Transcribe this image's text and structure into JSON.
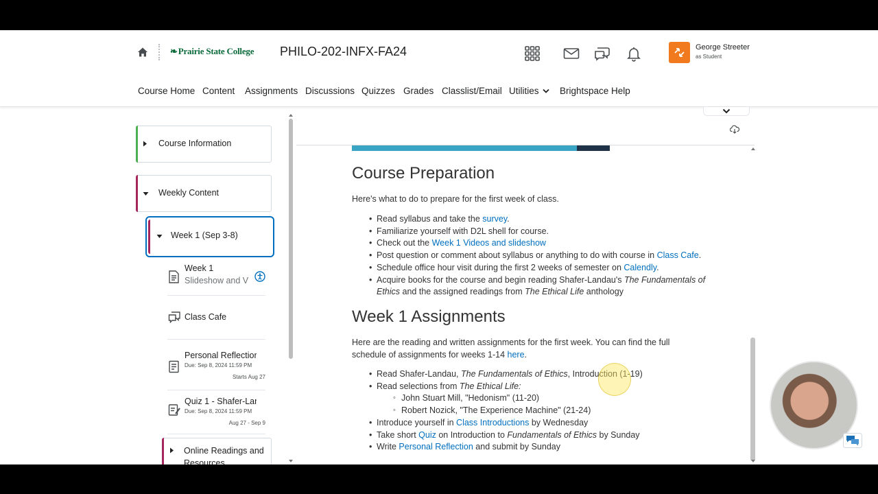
{
  "header": {
    "college_name": "Prairie State College",
    "course_code": "PHILO-202-INFX-FA24",
    "user_name": "George Streeter",
    "user_role": "as Student",
    "accent_color": "#f27a1e",
    "icons": [
      "home-icon",
      "apps-grid-icon",
      "mail-icon",
      "chat-icon",
      "bell-icon"
    ]
  },
  "nav": {
    "items": [
      "Course Home",
      "Content",
      "Assignments",
      "Discussions",
      "Quizzes",
      "Grades",
      "Classlist/Email",
      "Utilities",
      "Brightspace Help"
    ]
  },
  "sidebar": {
    "modules": [
      {
        "label": "Course Information",
        "bar_color": "#4caf50"
      },
      {
        "label": "Weekly Content",
        "bar_color": "#a3275d"
      },
      {
        "label": "Week 1 (Sep 3-8)",
        "bar_color": "#a3275d"
      },
      {
        "label": "Online Readings and Resources",
        "bar_color": "#a3275d"
      }
    ],
    "topics": [
      {
        "line1": "Week 1",
        "line2": "Slideshow and V",
        "icon": "document-icon"
      },
      {
        "name": "Class Cafe",
        "icon": "discussion-icon"
      },
      {
        "name": "Personal Reflection",
        "due": "Due: Sep 8, 2024 11:59 PM",
        "dates": "Starts Aug 27",
        "icon": "assignment-icon"
      },
      {
        "name": "Quiz 1 - Shafer-Lan",
        "due": "Due: Sep 8, 2024 11:59 PM",
        "dates": "Aug 27 - Sep 9",
        "icon": "quiz-icon"
      }
    ]
  },
  "doc": {
    "prep_heading": "Course Preparation",
    "prep_intro": "Here's what to do to prepare for the first week of class.",
    "prep_items": {
      "i1_pre": "Read syllabus and take the ",
      "i1_link": "survey",
      "i1_post": ".",
      "i2": "Familiarize yourself with D2L shell for course.",
      "i3_pre": "Check out the ",
      "i3_link": "Week 1 Videos and slideshow",
      "i4_pre": "Post question or comment about syllabus or anything to do with course in ",
      "i4_link": "Class Cafe",
      "i4_post": ".",
      "i5_pre": "Schedule office hour visit during the first 2 weeks of semester on ",
      "i5_link": "Calendly",
      "i5_post": ".",
      "i6_pre": "Acquire books for the course and begin reading Shafer-Landau's ",
      "i6_em1": "The Fundamentals of Ethics",
      "i6_mid": " and the assigned readings from ",
      "i6_em2": "The Ethical Life",
      "i6_post": " anthology"
    },
    "assign_heading": "Week 1 Assignments",
    "assign_intro_pre": "Here are the reading and written assignments for the first week. You can find the full schedule of assignments for weeks 1-14 ",
    "assign_intro_link": "here",
    "assign_intro_post": ".",
    "assign_items": {
      "a1_pre": "Read Shafer-Landau, ",
      "a1_em": "The Fundamentals of Ethics",
      "a1_post": ", Introduction (1-19)",
      "a2_pre": "Read selections from ",
      "a2_em": "The Ethical Life:",
      "a2_s1": "John Stuart Mill, \"Hedonism\" (11-20)",
      "a2_s2": "Robert Nozick, \"The Experience Machine\" (21-24)",
      "a3_pre": "Introduce yourself in ",
      "a3_link": "Class Introductions",
      "a3_post": " by Wednesday",
      "a4_pre": "Take short ",
      "a4_link": "Quiz",
      "a4_mid": " on Introduction to ",
      "a4_em": "Fundamentals of Ethics",
      "a4_post": " by Sunday",
      "a5_pre": "Write ",
      "a5_link": "Personal Reflection",
      "a5_post": " and submit by Sunday"
    },
    "link_color": "#006fbf"
  }
}
